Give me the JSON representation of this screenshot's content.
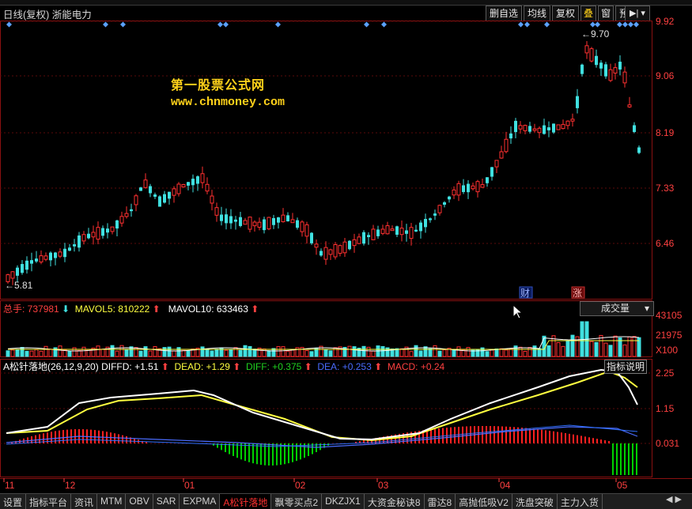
{
  "header": {
    "title": "日线(复权)  浙能电力",
    "buttons": [
      "删自选",
      "均线",
      "复权",
      "叠",
      "窗",
      "预测"
    ],
    "nav_icon": "▶|"
  },
  "price_axis": {
    "ticks": [
      "9.92",
      "9.06",
      "8.19",
      "7.33",
      "6.46"
    ]
  },
  "annotations": {
    "high_label": "9.70",
    "low_label": "5.81",
    "event_cai": "财",
    "event_zhang": "涨"
  },
  "watermark": {
    "line1": "第一股票公式网",
    "line2": "www.chnmoney.com"
  },
  "volume": {
    "label": "总手: ",
    "value": "737981",
    "ma5_label": "MAVOL5: ",
    "ma5": "810222",
    "ma10_label": "MAVOL10: ",
    "ma10": "633463",
    "selector": "成交量",
    "axis_ticks": [
      "43105",
      "21975",
      "X100"
    ]
  },
  "macd": {
    "name": "A松针落地(26,12,9,20)",
    "diffd_label": "DIFFD: ",
    "diffd": "+1.51",
    "dead_label": "DEAD: ",
    "dead": "+1.29",
    "diff_label": "DIFF: ",
    "diff": "+0.375",
    "dea_label": "DEA: ",
    "dea": "+0.253",
    "macd_label": "MACD: ",
    "macd": "+0.24",
    "help": "指标说明",
    "axis_ticks": [
      "2.25",
      "1.15",
      "0.031"
    ]
  },
  "date_axis": [
    "11",
    "12",
    "01",
    "02",
    "03",
    "04",
    "05"
  ],
  "tabs": [
    "设置",
    "指标平台",
    "资讯",
    "MTM",
    "OBV",
    "SAR",
    "EXPMA",
    "A松针落地",
    "飘零买点2",
    "DKZJX1",
    "大资金秘诀8",
    "雷达8",
    "高抛低吸V2",
    "洗盘突破",
    "主力入货"
  ],
  "active_tab": "A松针落地",
  "colors": {
    "up": "#ff3030",
    "down": "#40e0e0",
    "yellow": "#ffff40",
    "white": "#ffffff",
    "blue": "#4a6cff",
    "green": "#00d000",
    "grid": "#8a1010"
  }
}
